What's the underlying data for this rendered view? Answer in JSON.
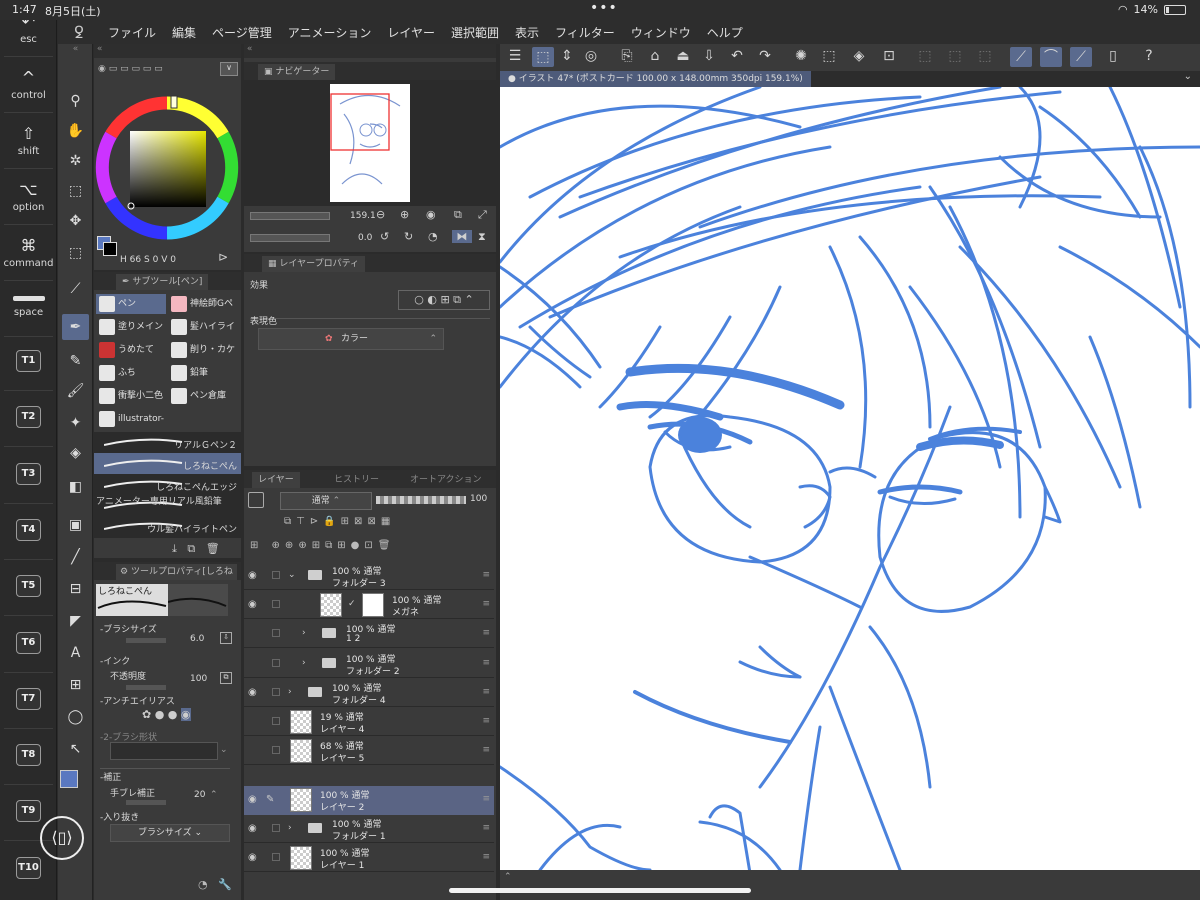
{
  "status_bar": {
    "time": "1:47",
    "date": "8月5日(土)",
    "dots": "•••",
    "battery": "14%"
  },
  "menu": {
    "items": [
      "ファイル",
      "編集",
      "ページ管理",
      "アニメーション",
      "レイヤー",
      "選択範囲",
      "表示",
      "フィルター",
      "ウィンドウ",
      "ヘルプ"
    ]
  },
  "shortcuts": {
    "esc": "esc",
    "control": "control",
    "shift": "shift",
    "option": "option",
    "command": "command",
    "space": "space",
    "t_keys": [
      "T1",
      "T2",
      "T3",
      "T4",
      "T5",
      "T6",
      "T7",
      "T8",
      "T9",
      "T10"
    ]
  },
  "color_panel": {
    "h_value": "66",
    "s_label": "S",
    "s_value": "0",
    "v_label": "V",
    "v_value": "0",
    "main_color": "#5a78c0"
  },
  "navigator": {
    "tab_label": "ナビゲーター",
    "zoom": "159.1",
    "rotation": "0.0"
  },
  "layer_property": {
    "tab_label": "レイヤープロパティ",
    "effect_label": "効果",
    "expression_label": "表現色",
    "expression_value": "カラー"
  },
  "subtool": {
    "tab_label": "サブツール[ペン]",
    "items": [
      {
        "label": "ペン"
      },
      {
        "label": "神絵師Gペ"
      },
      {
        "label": "塗りメイン"
      },
      {
        "label": "髪ハイライ"
      },
      {
        "label": "うめたて"
      },
      {
        "label": "削り・カケ"
      },
      {
        "label": "ふち"
      },
      {
        "label": "鉛筆"
      },
      {
        "label": "衝撃小二色"
      },
      {
        "label": "ペン倉庫"
      },
      {
        "label": "illustrator-k"
      }
    ],
    "brushes": [
      "リアルＧペン２",
      "しろねこぺん",
      "しろねこぺんエッジ",
      "アニメーター専用リアル風鉛筆",
      "ウル髪ハイライトペン"
    ]
  },
  "tool_property": {
    "tab_label": "ツールプロパティ[しろね",
    "preview_name": "しろねこぺん",
    "brush_size_label": "ブラシサイズ",
    "brush_size_value": "6.0",
    "ink_label": "インク",
    "opacity_label": "不透明度",
    "opacity_value": "100",
    "antialias_label": "アンチエイリアス",
    "brush_shape_label": "2-ブラシ形状",
    "correction_label": "補正",
    "stabilization_label": "手ブレ補正",
    "stabilization_value": "20",
    "taper_label": "入り抜き",
    "taper_value": "ブラシサイズ"
  },
  "layers_panel": {
    "tabs": [
      "レイヤー",
      "ヒストリー",
      "オートアクション"
    ],
    "blend_mode": "通常",
    "opacity": "100",
    "layers": [
      {
        "pct": "100 %  通常",
        "name": "フォルダー 3"
      },
      {
        "pct": "100 %  通常",
        "name": "メガネ"
      },
      {
        "pct": "100 %  通常",
        "name": "1 2"
      },
      {
        "pct": "100 %  通常",
        "name": "フォルダー 2"
      },
      {
        "pct": "100 %  通常",
        "name": "フォルダー 4"
      },
      {
        "pct": "19 %  通常",
        "name": "レイヤー 4"
      },
      {
        "pct": "68 %  通常",
        "name": "レイヤー 5"
      },
      {
        "pct": "100 %  通常",
        "name": "レイヤー 2"
      },
      {
        "pct": "100 %  通常",
        "name": "フォルダー 1"
      },
      {
        "pct": "100 %  通常",
        "name": "レイヤー 1"
      }
    ]
  },
  "canvas": {
    "doc_tab": "イラスト 47* (ポストカード 100.00 x 148.00mm 350dpi 159.1%)",
    "line_color": "#4b82dc"
  }
}
